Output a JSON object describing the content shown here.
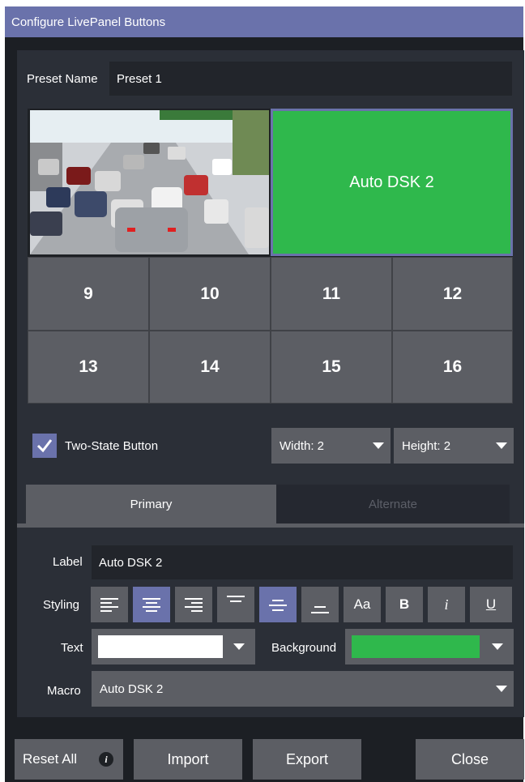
{
  "window": {
    "title": "Configure LivePanel Buttons"
  },
  "preset": {
    "label": "Preset Name",
    "value": "Preset 1"
  },
  "grid": {
    "large_image_desc": "traffic-photo",
    "auto_dsk_label": "Auto DSK 2",
    "cells": [
      "9",
      "10",
      "11",
      "12",
      "13",
      "14",
      "15",
      "16"
    ]
  },
  "options": {
    "two_state_label": "Two-State Button",
    "two_state_checked": true,
    "width_label": "Width: 2",
    "height_label": "Height: 2"
  },
  "tabs": {
    "primary": "Primary",
    "alternate": "Alternate",
    "selected": "Primary"
  },
  "form": {
    "label_label": "Label",
    "label_value": "Auto DSK 2",
    "styling_label": "Styling",
    "styling_buttons": {
      "align_left_icon": "align-left-icon",
      "align_center_icon": "align-center-icon",
      "align_right_icon": "align-right-icon",
      "valign_top_icon": "valign-top-icon",
      "valign_middle_icon": "valign-middle-icon",
      "valign_bottom_icon": "valign-bottom-icon",
      "font_label": "Aa",
      "bold_label": "B",
      "italic_label": "i",
      "underline_label": "U"
    },
    "text_label": "Text",
    "text_color": "#ffffff",
    "background_label": "Background",
    "background_color": "#2fb84c",
    "macro_label": "Macro",
    "macro_value": "Auto DSK 2"
  },
  "footer": {
    "reset_label": "Reset All",
    "info_icon": "info-icon",
    "import_label": "Import",
    "export_label": "Export",
    "close_label": "Close"
  },
  "colors": {
    "accent": "#6a72ab",
    "green": "#2fb84c",
    "panel": "#2b2f37",
    "button": "#5c5e64"
  }
}
